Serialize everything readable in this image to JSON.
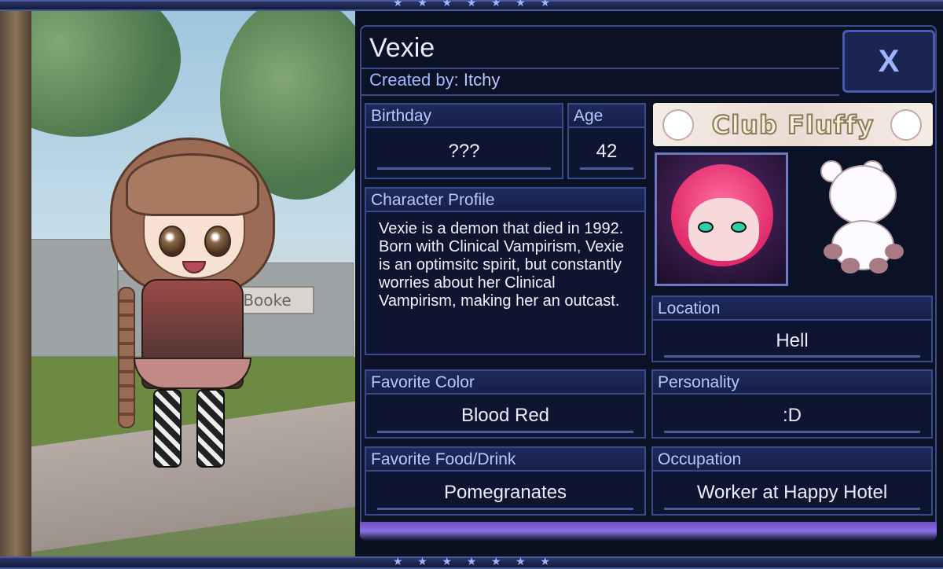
{
  "character": {
    "name": "Vexie",
    "created_by_label": "Created by:",
    "created_by": "Itchy"
  },
  "close": {
    "label": "X"
  },
  "fields": {
    "birthday": {
      "label": "Birthday",
      "value": "???"
    },
    "age": {
      "label": "Age",
      "value": "42"
    },
    "profile": {
      "label": "Character Profile",
      "text": "Vexie is a demon that died in 1992. Born with Clinical Vampirism, Vexie is an optimsitc spirit, but constantly worries about her Clinical Vampirism, making her an outcast."
    },
    "location": {
      "label": "Location",
      "value": "Hell"
    },
    "favorite_color": {
      "label": "Favorite Color",
      "value": "Blood Red"
    },
    "personality": {
      "label": "Personality",
      "value": ":D"
    },
    "favorite_food": {
      "label": "Favorite Food/Drink",
      "value": "Pomegranates"
    },
    "occupation": {
      "label": "Occupation",
      "value": "Worker at Happy Hotel"
    }
  },
  "banner": {
    "text": "Club Fluffy"
  },
  "scene": {
    "sign_text": "Booke"
  },
  "icons": {
    "star": "★",
    "close": "close-icon"
  },
  "colors": {
    "panel_bg": "#0c1226",
    "border": "#3b4a8a",
    "label_text": "#b8c8ff",
    "value_text": "#e8ecff",
    "accent_purple": "#6b4fc7"
  }
}
